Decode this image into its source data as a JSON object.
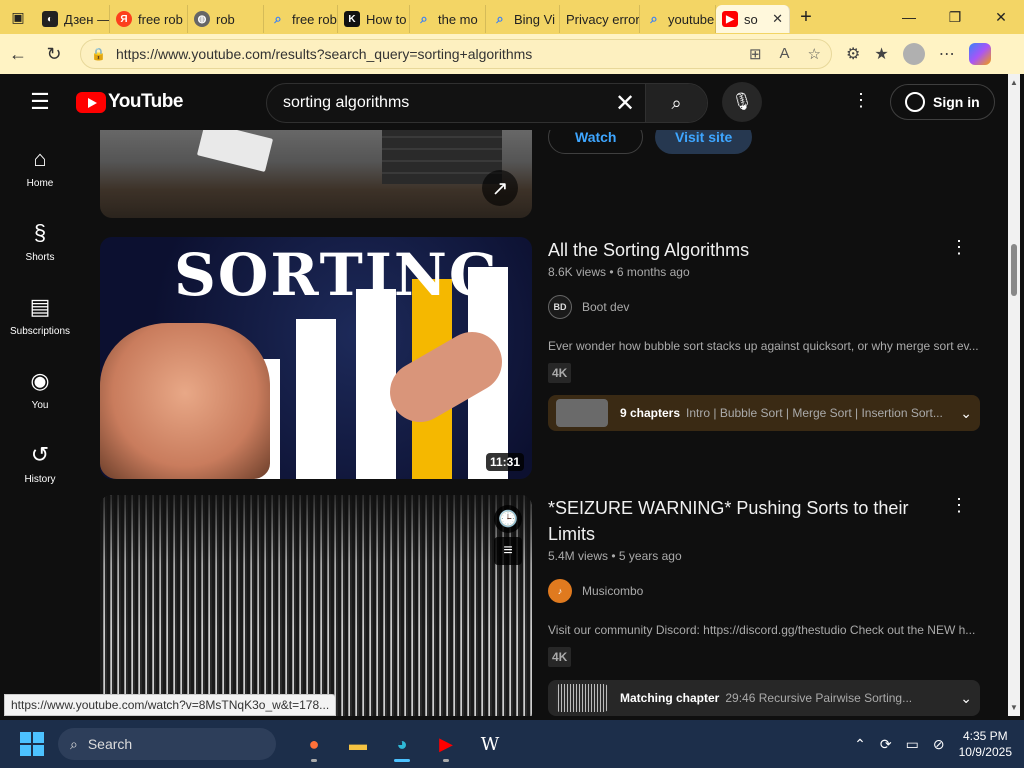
{
  "browser": {
    "tabs": [
      {
        "label": "Дзен —",
        "icon": "dzen-icon",
        "color": "#222222"
      },
      {
        "label": "free rob",
        "icon": "yandex-icon",
        "color": "#fc3f1d"
      },
      {
        "label": "rob",
        "icon": "globe-icon",
        "color": "#555555"
      },
      {
        "label": "free rob",
        "icon": "search-icon",
        "color": "#3b82f6"
      },
      {
        "label": "How to",
        "icon": "k-icon",
        "color": "#111111"
      },
      {
        "label": "the mo",
        "icon": "search-icon",
        "color": "#3b82f6"
      },
      {
        "label": "Bing Vi",
        "icon": "search-icon",
        "color": "#3b82f6"
      },
      {
        "label": "Privacy error",
        "icon": "warning-icon",
        "color": "#d93025"
      },
      {
        "label": "youtube",
        "icon": "search-icon",
        "color": "#3b82f6"
      },
      {
        "label": "so",
        "icon": "youtube-icon",
        "color": "#ff0000"
      }
    ],
    "url": "https://www.youtube.com/results?search_query=sorting+algorithms",
    "status_url": "https://www.youtube.com/watch?v=8MsTNqK3o_w&t=178..."
  },
  "youtube": {
    "logo": "YouTube",
    "search_query": "sorting algorithms",
    "sign_in": "Sign in",
    "sidebar": [
      {
        "label": "Home",
        "icon": "home-icon"
      },
      {
        "label": "Shorts",
        "icon": "shorts-icon"
      },
      {
        "label": "Subscriptions",
        "icon": "subscriptions-icon"
      },
      {
        "label": "You",
        "icon": "you-icon"
      },
      {
        "label": "History",
        "icon": "history-icon"
      }
    ],
    "ad": {
      "watch": "Watch",
      "visit": "Visit site"
    },
    "results": [
      {
        "title": "All the Sorting Algorithms",
        "views": "8.6K views",
        "age": "6 months ago",
        "channel": "Boot dev",
        "channel_avatar": "BD",
        "description": "Ever wonder how bubble sort stacks up against quicksort, or why merge sort ev...",
        "badge": "4K",
        "duration": "11:31",
        "thumb_text": "SORTING",
        "chapters_label": "9 chapters",
        "chapters_text": "Intro | Bubble Sort | Merge Sort | Insertion Sort..."
      },
      {
        "title": "*SEIZURE WARNING* Pushing Sorts to their Limits",
        "views": "5.4M views",
        "age": "5 years ago",
        "channel": "Musicombo",
        "description": "Visit our community Discord: https://discord.gg/thestudio Check out the NEW h...",
        "badge": "4K",
        "chapters_label": "Matching chapter",
        "chapters_text": "29:46 Recursive Pairwise Sorting..."
      }
    ]
  },
  "taskbar": {
    "search": "Search",
    "time": "4:35 PM",
    "date": "10/9/2025"
  }
}
